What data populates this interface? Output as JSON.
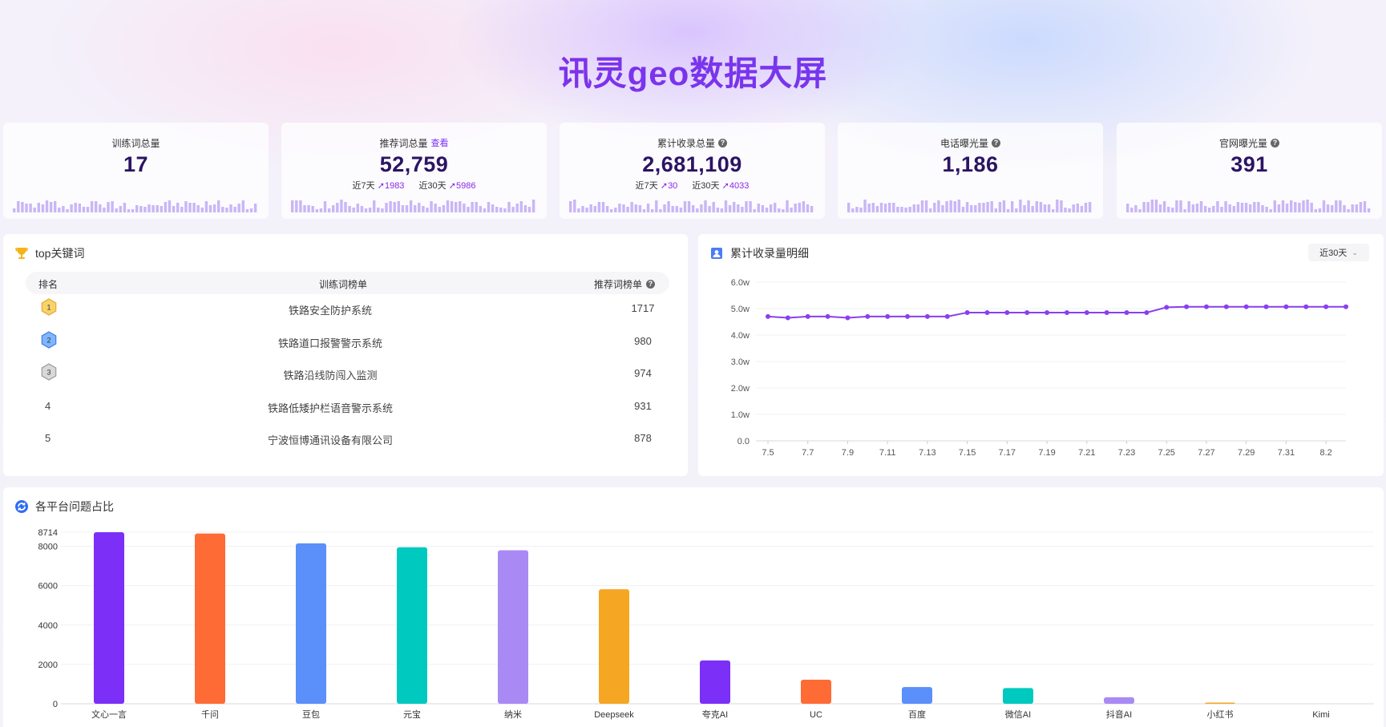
{
  "header": {
    "title": "讯灵geo数据大屏"
  },
  "stats": [
    {
      "label": "训练词总量",
      "value": "17",
      "has_help": false,
      "link": "",
      "sub": []
    },
    {
      "label": "推荐词总量",
      "value": "52,759",
      "has_help": false,
      "link": "查看",
      "sub": [
        {
          "label": "近7天",
          "value": "1983"
        },
        {
          "label": "近30天",
          "value": "5986"
        }
      ]
    },
    {
      "label": "累计收录总量",
      "value": "2,681,109",
      "has_help": true,
      "link": "",
      "sub": [
        {
          "label": "近7天",
          "value": "30"
        },
        {
          "label": "近30天",
          "value": "4033"
        }
      ]
    },
    {
      "label": "电话曝光量",
      "value": "1,186",
      "has_help": true,
      "link": "",
      "sub": []
    },
    {
      "label": "官网曝光量",
      "value": "391",
      "has_help": true,
      "link": "",
      "sub": []
    }
  ],
  "keywords": {
    "title": "top关键词",
    "columns": {
      "rank": "排名",
      "train": "训练词榜单",
      "recommend": "推荐词榜单"
    },
    "rows": [
      {
        "rank": "1",
        "name": "铁路安全防护系统",
        "count": "1717"
      },
      {
        "rank": "2",
        "name": "铁路道口报警警示系统",
        "count": "980"
      },
      {
        "rank": "3",
        "name": "铁路沿线防闯入监测",
        "count": "974"
      },
      {
        "rank": "4",
        "name": "铁路低矮护栏语音警示系统",
        "count": "931"
      },
      {
        "rank": "5",
        "name": "宁波恒博通讯设备有限公司",
        "count": "878"
      }
    ]
  },
  "collection": {
    "title": "累计收录量明细",
    "range_selector": "近30天"
  },
  "platforms": {
    "title": "各平台问题占比"
  },
  "colors": {
    "accent": "#7b2ff7",
    "line": "#8a3ff0",
    "spark": "#c9b6f5"
  },
  "chart_data": [
    {
      "type": "line",
      "title": "累计收录量明细",
      "x_ticks": [
        "7.5",
        "7.7",
        "7.9",
        "7.11",
        "7.13",
        "7.15",
        "7.17",
        "7.19",
        "7.21",
        "7.23",
        "7.25",
        "7.27",
        "7.29",
        "7.31",
        "8.2"
      ],
      "y_ticks": [
        "0.0",
        "1.0w",
        "2.0w",
        "3.0w",
        "4.0w",
        "5.0w",
        "6.0w"
      ],
      "ylim": [
        0,
        6
      ],
      "y_unit": "w",
      "x": [
        "7.5",
        "7.6",
        "7.7",
        "7.8",
        "7.9",
        "7.10",
        "7.11",
        "7.12",
        "7.13",
        "7.14",
        "7.15",
        "7.16",
        "7.17",
        "7.18",
        "7.19",
        "7.20",
        "7.21",
        "7.22",
        "7.23",
        "7.24",
        "7.25",
        "7.26",
        "7.27",
        "7.28",
        "7.29",
        "7.30",
        "7.31",
        "8.1",
        "8.2",
        "8.3"
      ],
      "values": [
        4.7,
        4.65,
        4.7,
        4.7,
        4.65,
        4.7,
        4.7,
        4.7,
        4.7,
        4.7,
        4.85,
        4.85,
        4.85,
        4.85,
        4.85,
        4.85,
        4.85,
        4.85,
        4.85,
        4.85,
        5.05,
        5.07,
        5.07,
        5.07,
        5.07,
        5.07,
        5.07,
        5.07,
        5.07,
        5.07
      ]
    },
    {
      "type": "bar",
      "title": "各平台问题占比",
      "categories": [
        "文心一言",
        "千问",
        "豆包",
        "元宝",
        "纳米",
        "Deepseek",
        "夸克AI",
        "UC",
        "百度",
        "微信AI",
        "抖音AI",
        "小红书",
        "Kimi"
      ],
      "values": [
        8714,
        8650,
        8150,
        7950,
        7800,
        5820,
        2200,
        1220,
        850,
        800,
        330,
        60,
        0
      ],
      "colors": [
        "#7b2ff7",
        "#ff6b35",
        "#5b8ff9",
        "#00c9c0",
        "#a98af5",
        "#f5a623",
        "#7b2ff7",
        "#ff6b35",
        "#5b8ff9",
        "#00c9c0",
        "#a98af5",
        "#f5a623",
        "#7b2ff7"
      ],
      "y_ticks": [
        "0",
        "2000",
        "4000",
        "6000",
        "8000",
        "8714"
      ],
      "ylim": [
        0,
        8714
      ]
    }
  ]
}
